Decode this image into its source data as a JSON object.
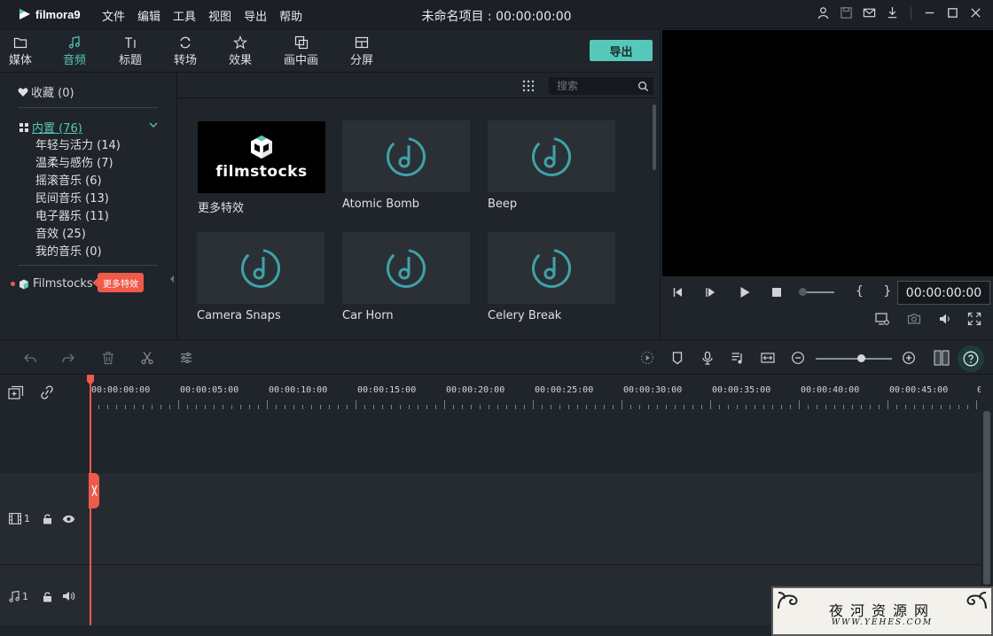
{
  "app": {
    "name": "filmora9",
    "project_title": "未命名项目 : 00:00:00:00"
  },
  "menu": [
    "文件",
    "编辑",
    "工具",
    "视图",
    "导出",
    "帮助"
  ],
  "tabs": [
    {
      "label": "媒体",
      "icon": "folder-icon"
    },
    {
      "label": "音频",
      "icon": "music-note-icon",
      "active": true
    },
    {
      "label": "标题",
      "icon": "title-text-icon"
    },
    {
      "label": "转场",
      "icon": "transition-icon"
    },
    {
      "label": "效果",
      "icon": "effects-icon"
    },
    {
      "label": "画中画",
      "icon": "pip-icon"
    },
    {
      "label": "分屏",
      "icon": "split-screen-icon"
    }
  ],
  "export_label": "导出",
  "sidebar": {
    "favorites": "收藏 (0)",
    "builtin": "内置 (76)",
    "categories": [
      "年轻与活力 (14)",
      "温柔与感伤 (7)",
      "摇滚音乐 (6)",
      "民间音乐 (13)",
      "电子器乐 (11)",
      "音效 (25)",
      "我的音乐 (0)"
    ],
    "filmstocks": "Filmstocks",
    "badge": "更多特效"
  },
  "search": {
    "placeholder": "搜索"
  },
  "library": [
    {
      "label": "更多特效",
      "thumb": "filmstocks",
      "thumb_text": "filmstocks"
    },
    {
      "label": "Atomic Bomb",
      "thumb": "music-note-icon"
    },
    {
      "label": "Beep",
      "thumb": "music-note-icon"
    },
    {
      "label": "Camera Snaps",
      "thumb": "music-note-icon"
    },
    {
      "label": "Car Horn",
      "thumb": "music-note-icon"
    },
    {
      "label": "Celery Break",
      "thumb": "music-note-icon"
    }
  ],
  "preview": {
    "timecode": "00:00:00:00",
    "brackets": "{ }"
  },
  "ruler": [
    "00:00:00:00",
    "00:00:05:00",
    "00:00:10:00",
    "00:00:15:00",
    "00:00:20:00",
    "00:00:25:00",
    "00:00:30:00",
    "00:00:35:00",
    "00:00:40:00",
    "00:00:45:00",
    "0"
  ],
  "tracks": {
    "video_label": "1",
    "audio_label": "1"
  },
  "watermark": {
    "line1": "夜河资源网",
    "line2": "WWW.YEHES.COM"
  },
  "colors": {
    "accent": "#56c7b8",
    "playhead": "#ef5a4a",
    "panel": "#20252b",
    "track": "#262b32"
  }
}
